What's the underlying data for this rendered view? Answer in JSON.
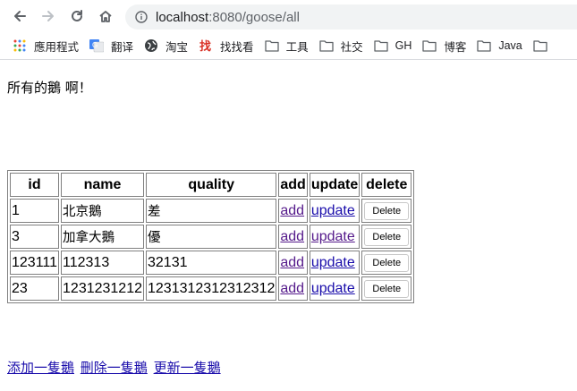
{
  "browser": {
    "url_host": "localhost",
    "url_path": ":8080/goose/all"
  },
  "bookmarks": [
    {
      "label": "應用程式",
      "icon": "apps-grid-icon"
    },
    {
      "label": "翻译",
      "icon": "google-translate-icon"
    },
    {
      "label": "淘宝",
      "icon": "globe-icon"
    },
    {
      "label": "找找看",
      "icon": "zhaozhaokan-icon"
    },
    {
      "label": "工具",
      "icon": "folder-icon"
    },
    {
      "label": "社交",
      "icon": "folder-icon"
    },
    {
      "label": "GH",
      "icon": "folder-icon"
    },
    {
      "label": "博客",
      "icon": "folder-icon"
    },
    {
      "label": "Java",
      "icon": "folder-icon"
    },
    {
      "label": "",
      "icon": "folder-icon"
    }
  ],
  "page": {
    "heading": "所有的鵝 啊！",
    "table": {
      "headers": [
        "id",
        "name",
        "quality",
        "add",
        "update",
        "delete"
      ],
      "rows": [
        {
          "id": "1",
          "name": "北京鵝",
          "quality": "差",
          "add": "add",
          "update": "update",
          "delete": "Delete"
        },
        {
          "id": "3",
          "name": "加拿大鵝",
          "quality": "優",
          "add": "add",
          "update": "update",
          "delete": "Delete"
        },
        {
          "id": "123111",
          "name": "112313",
          "quality": "32131",
          "add": "add",
          "update": "update",
          "delete": "Delete"
        },
        {
          "id": "23",
          "name": "1231231212",
          "quality": "1231312312312312",
          "add": "add",
          "update": "update",
          "delete": "Delete"
        }
      ]
    },
    "footer_links": [
      "添加一隻鵝",
      "刪除一隻鵝",
      "更新一隻鵝"
    ]
  }
}
